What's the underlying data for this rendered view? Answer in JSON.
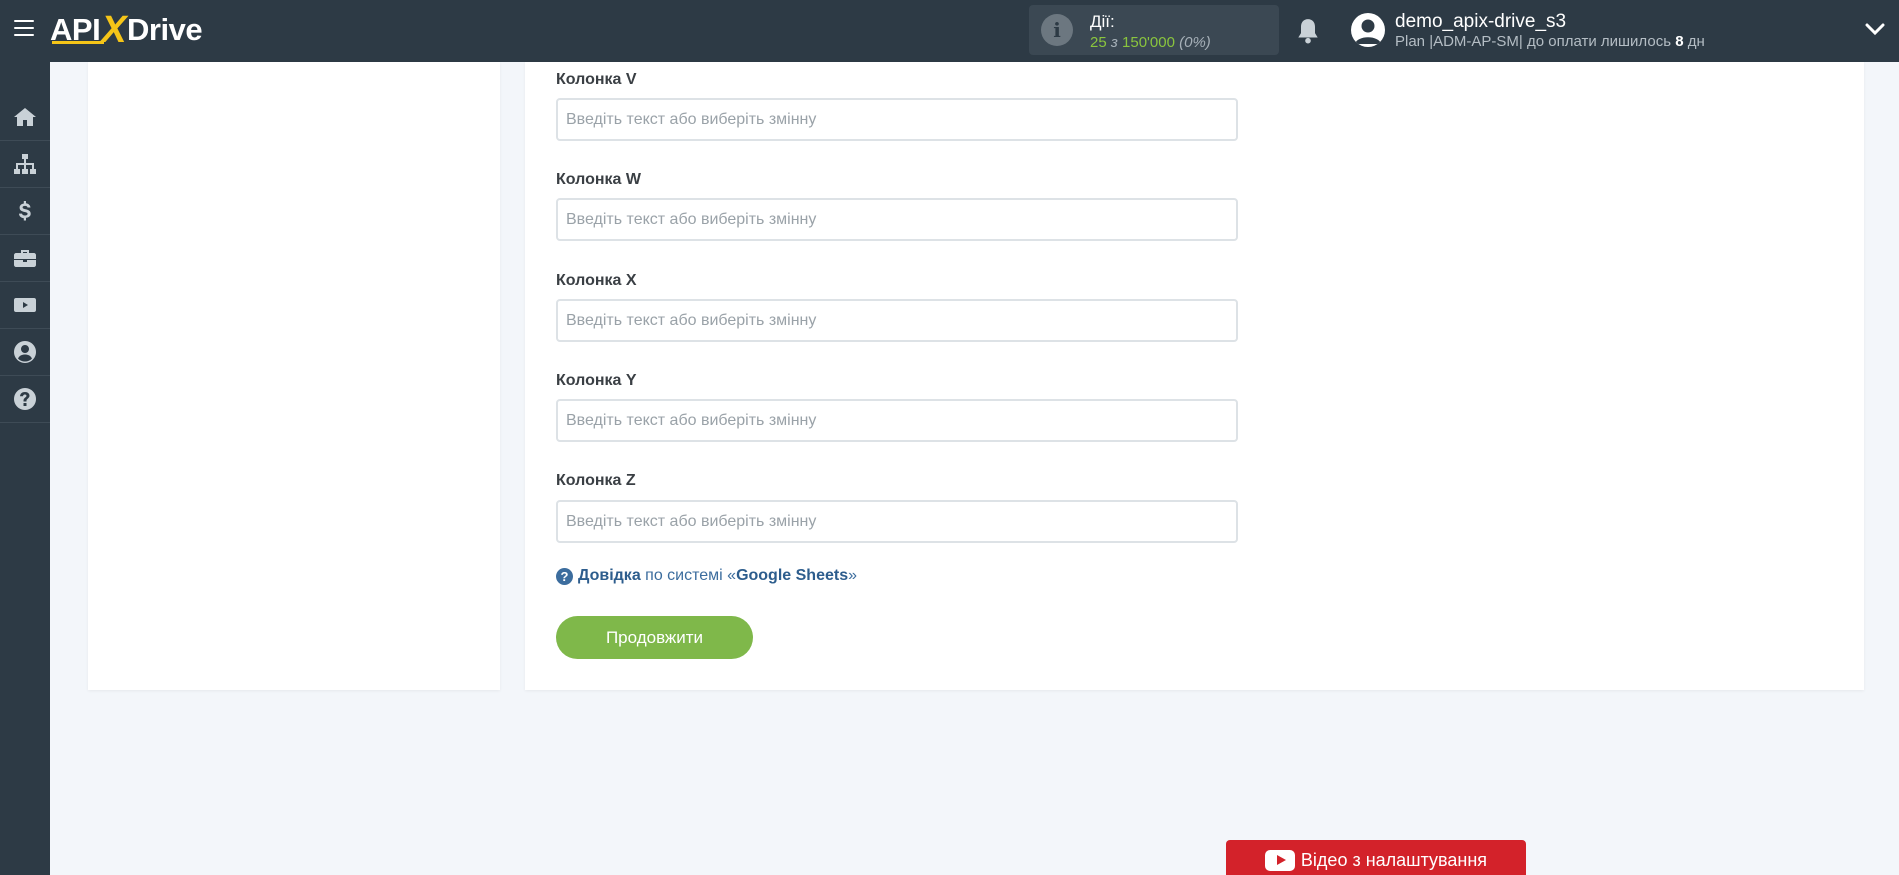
{
  "header": {
    "logo_left": "API",
    "logo_x": "X",
    "logo_right": "Drive",
    "actions_label": "Дії:",
    "actions_count": "25",
    "actions_sep": "з",
    "actions_limit": "150'000",
    "actions_percent": "(0%)",
    "user_name": "demo_apix-drive_s3",
    "plan_text": "Plan |ADM-AP-SM| до оплати лишилось",
    "plan_days": "8",
    "plan_days_unit": "дн"
  },
  "sidebar": {
    "items": [
      {
        "name": "home",
        "icon": "home-icon"
      },
      {
        "name": "connections",
        "icon": "sitemap-icon"
      },
      {
        "name": "billing",
        "icon": "dollar-icon"
      },
      {
        "name": "tools",
        "icon": "briefcase-icon"
      },
      {
        "name": "video",
        "icon": "youtube-icon"
      },
      {
        "name": "account",
        "icon": "user-circle-icon"
      },
      {
        "name": "help",
        "icon": "question-circle-icon"
      }
    ]
  },
  "form": {
    "placeholder": "Введіть текст або виберіть змінну",
    "fields": [
      {
        "label": "Колонка V",
        "value": ""
      },
      {
        "label": "Колонка W",
        "value": ""
      },
      {
        "label": "Колонка X",
        "value": ""
      },
      {
        "label": "Колонка Y",
        "value": ""
      },
      {
        "label": "Колонка Z",
        "value": ""
      }
    ],
    "help_strong": "Довідка",
    "help_mid": "по системі «",
    "help_system": "Google Sheets",
    "help_end": "»",
    "continue_label": "Продовжити"
  },
  "video_button": {
    "label": "Відео з налаштування"
  },
  "colors": {
    "topbar": "#2d3a45",
    "accent_green": "#7fb84a",
    "logo_yellow": "#f5c518",
    "video_red": "#d3222a"
  }
}
